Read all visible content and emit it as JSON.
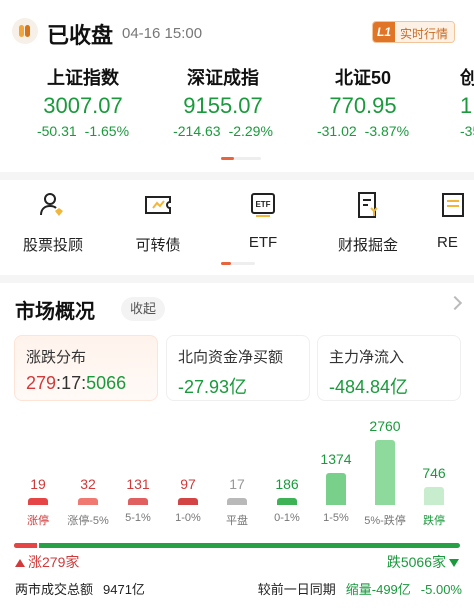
{
  "header": {
    "status": "已收盘",
    "time": "04-16 15:00",
    "realtime_level": "L1",
    "realtime_label": "实时行情"
  },
  "indices": [
    {
      "name": "上证指数",
      "price": "3007.07",
      "change": "-50.31",
      "pct": "-1.65%"
    },
    {
      "name": "深证成指",
      "price": "9155.07",
      "change": "-214.63",
      "pct": "-2.29%"
    },
    {
      "name": "北证50",
      "price": "770.95",
      "change": "-31.02",
      "pct": "-3.87%"
    },
    {
      "name": "创",
      "price": "1",
      "change": "-35",
      "pct": ""
    }
  ],
  "tools": [
    {
      "label": "股票投顾",
      "icon": "advisor-icon"
    },
    {
      "label": "可转债",
      "icon": "convertible-bond-icon"
    },
    {
      "label": "ETF",
      "icon": "etf-icon"
    },
    {
      "label": "财报掘金",
      "icon": "financial-report-icon"
    },
    {
      "label": "RE",
      "icon": "report-icon"
    }
  ],
  "market": {
    "title": "市场概况",
    "collapse_label": "收起",
    "cards": [
      {
        "title": "涨跌分布",
        "up": "279",
        "sep1": ":",
        "flat": "17",
        "sep2": ":",
        "down": "5066"
      },
      {
        "title": "北向资金净买额",
        "value": "-27.93亿"
      },
      {
        "title": "主力净流入",
        "value": "-484.84亿"
      }
    ],
    "distribution": [
      {
        "label": "涨停",
        "value": 19,
        "color": "#e64545"
      },
      {
        "label": "涨停-5%",
        "value": 32,
        "color": "#f07a72"
      },
      {
        "label": "5-1%",
        "value": 131,
        "color": "#e06060"
      },
      {
        "label": "1-0%",
        "value": 97,
        "color": "#d34545"
      },
      {
        "label": "平盘",
        "value": 17,
        "color": "#b9b9b9"
      },
      {
        "label": "0-1%",
        "value": 186,
        "color": "#3db356"
      },
      {
        "label": "1-5%",
        "value": 1374,
        "color": "#78d08a"
      },
      {
        "label": "5%-跌停",
        "value": 2760,
        "color": "#8ed99c"
      },
      {
        "label": "跌停",
        "value": 746,
        "color": "#c7ecce"
      }
    ],
    "up_text": "涨279家",
    "down_text": "跌5066家",
    "up_count": 279,
    "flat_count": 17,
    "down_count": 5066
  },
  "footer": {
    "turnover_label": "两市成交总额",
    "turnover_value": "9471亿",
    "compare_label": "较前一日同期",
    "compare_value": "缩量-499亿",
    "compare_pct": "-5.00%"
  },
  "colors": {
    "up": "#d03a3a",
    "down": "#1a9a3c",
    "accent": "#e8643c"
  }
}
